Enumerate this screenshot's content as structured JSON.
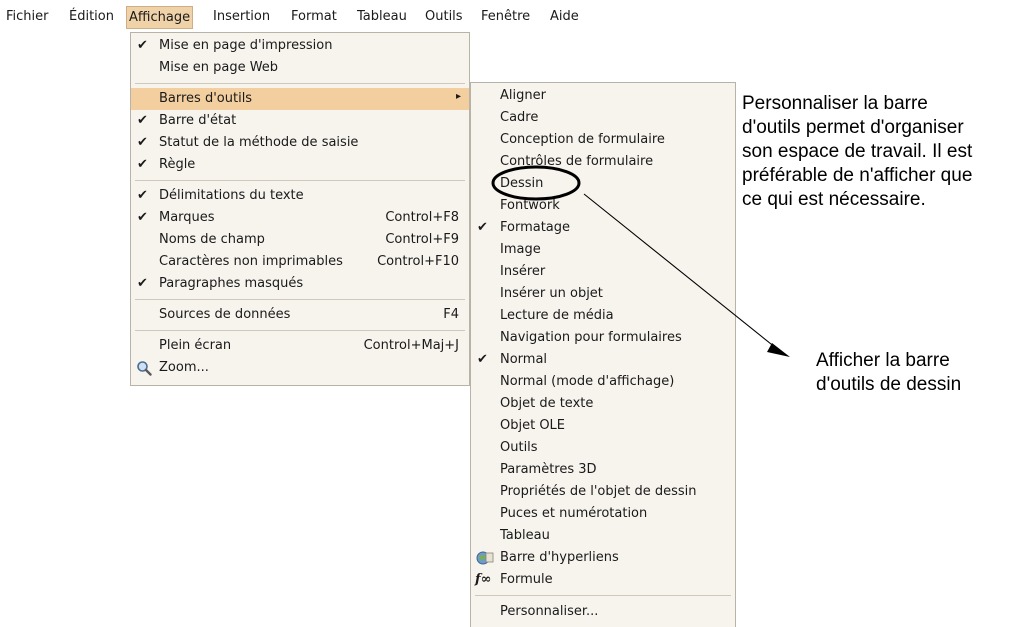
{
  "menubar": {
    "items": [
      "Fichier",
      "Édition",
      "Affichage",
      "Insertion",
      "Format",
      "Tableau",
      "Outils",
      "Fenêtre",
      "Aide"
    ]
  },
  "affichage_menu": {
    "items": [
      {
        "label": "Mise en page d'impression",
        "checked": "✔",
        "shortcut": ""
      },
      {
        "label": "Mise en page Web",
        "checked": "",
        "shortcut": ""
      },
      {
        "label": "Barres d'outils",
        "checked": "",
        "shortcut": "",
        "submenu_arrow": "▸"
      },
      {
        "label": "Barre d'état",
        "checked": "✔",
        "shortcut": ""
      },
      {
        "label": "Statut de la méthode de saisie",
        "checked": "✔",
        "shortcut": ""
      },
      {
        "label": "Règle",
        "checked": "✔",
        "shortcut": ""
      },
      {
        "label": "Délimitations du texte",
        "checked": "✔",
        "shortcut": ""
      },
      {
        "label": "Marques",
        "checked": "✔",
        "shortcut": "Control+F8"
      },
      {
        "label": "Noms de champ",
        "checked": "",
        "shortcut": "Control+F9"
      },
      {
        "label": "Caractères non imprimables",
        "checked": "",
        "shortcut": "Control+F10"
      },
      {
        "label": "Paragraphes masqués",
        "checked": "✔",
        "shortcut": ""
      },
      {
        "label": "Sources de données",
        "checked": "",
        "shortcut": "F4"
      },
      {
        "label": "Plein écran",
        "checked": "",
        "shortcut": "Control+Maj+J"
      },
      {
        "label": "Zoom...",
        "checked": "",
        "shortcut": ""
      }
    ]
  },
  "toolbars_submenu": {
    "items": [
      {
        "label": "Aligner",
        "checked": ""
      },
      {
        "label": "Cadre",
        "checked": ""
      },
      {
        "label": "Conception de formulaire",
        "checked": ""
      },
      {
        "label": "Contrôles de formulaire",
        "checked": ""
      },
      {
        "label": "Dessin",
        "checked": ""
      },
      {
        "label": "Fontwork",
        "checked": ""
      },
      {
        "label": "Formatage",
        "checked": "✔"
      },
      {
        "label": "Image",
        "checked": ""
      },
      {
        "label": "Insérer",
        "checked": ""
      },
      {
        "label": "Insérer un objet",
        "checked": ""
      },
      {
        "label": "Lecture de média",
        "checked": ""
      },
      {
        "label": "Navigation pour formulaires",
        "checked": ""
      },
      {
        "label": "Normal",
        "checked": "✔"
      },
      {
        "label": "Normal (mode d'affichage)",
        "checked": ""
      },
      {
        "label": "Objet de texte",
        "checked": ""
      },
      {
        "label": "Objet OLE",
        "checked": ""
      },
      {
        "label": "Outils",
        "checked": ""
      },
      {
        "label": "Paramètres 3D",
        "checked": ""
      },
      {
        "label": "Propriétés de l'objet de dessin",
        "checked": ""
      },
      {
        "label": "Puces et numérotation",
        "checked": ""
      },
      {
        "label": "Tableau",
        "checked": ""
      },
      {
        "label": "Barre d'hyperliens",
        "checked": ""
      },
      {
        "label": "Formule",
        "checked": ""
      },
      {
        "label": "Personnaliser...",
        "checked": ""
      }
    ]
  },
  "annotations": {
    "top": [
      "Personnaliser la barre",
      "d'outils permet d'organiser",
      "son espace de travail. Il est",
      "préférable de n'afficher que",
      "ce qui est nécessaire."
    ],
    "bottom": [
      "Afficher la barre",
      "d'outils de dessin"
    ]
  },
  "colors": {
    "menu_bg": "#f7f4ee",
    "highlight": "#f3cfa0",
    "text": "#1a1a1a"
  }
}
